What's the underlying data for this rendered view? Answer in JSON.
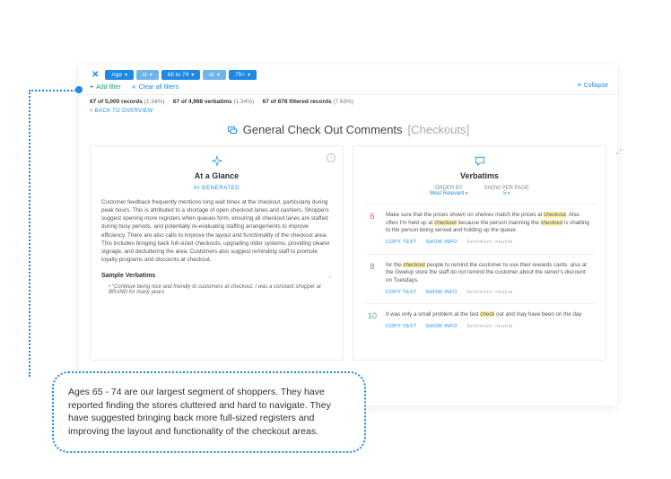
{
  "filters": {
    "close": "✕",
    "chips": [
      "Age",
      "is",
      "65 to 74",
      "or",
      "75+"
    ],
    "add": "Add filter",
    "clear": "Clear all filters",
    "collapse": "Collapse"
  },
  "records": {
    "a_bold": "67 of 5,000 records",
    "a_pct": "(1.34%)",
    "b_bold": "67 of 4,998 verbatims",
    "b_pct": "(1.34%)",
    "c_bold": "67 of 878 filtered records",
    "c_pct": "(7.63%)"
  },
  "back": "< BACK TO OVERVIEW",
  "title": {
    "main": "General Check Out Comments",
    "sub": "[Checkouts]"
  },
  "glance": {
    "heading": "At a Glance",
    "tag": "AI GENERATED",
    "body": "Customer feedback frequently mentions long wait times at the checkout, particularly during peak hours. This is attributed to a shortage of open checkout lanes and cashiers. Shoppers suggest opening more registers when queues form, ensuring all checkout lanes are staffed during busy periods, and potentially re-evaluating staffing arrangements to improve efficiency. There are also calls to improve the layout and functionality of the checkout area. This includes bringing back full-sized checkouts, upgrading older systems, providing clearer signage, and decluttering the area. Customers also suggest reminding staff to promote loyalty programs and discounts at checkout.",
    "sample_hdr": "Sample Verbatims",
    "quote": "\"Continue being nice and friendly to customers at checkout. I was a constant shopper at BRAND for many years"
  },
  "verbatims": {
    "heading": "Verbatims",
    "order_lbl": "ORDER BY",
    "order_val": "Most Relevant",
    "perpage_lbl": "SHOW PER PAGE",
    "perpage_val": "5",
    "items": [
      {
        "score": "6",
        "cls": "bad",
        "pre": "Make sure that the prices shown on shelves match the prices at ",
        "hl1": "checkout",
        "mid1": ". Also often I'm held up at ",
        "hl2": "checkout",
        "post": " because the person manning the ",
        "hl3": "checkout",
        "tail": " is chatting to the person being served and holding up the queue."
      },
      {
        "score": "8",
        "cls": "mid",
        "pre": "for the ",
        "hl1": "checkout",
        "mid1": " people to remind the customer to use their rewards cards. also at the Gwelup store the staff do not remind the customer about the senior's discount on Tuesdays.",
        "hl2": "",
        "post": "",
        "hl3": "",
        "tail": ""
      },
      {
        "score": "10",
        "cls": "good",
        "pre": "It was only a small problem at the fast ",
        "hl1": "check",
        "mid1": " out and may have been on the day",
        "hl2": "",
        "post": "",
        "hl3": "",
        "tail": ""
      }
    ],
    "copy": "COPY TEXT",
    "showinfo": "SHOW INFO",
    "sentiment": "Sentiment: neutral"
  },
  "callout": "Ages  65 - 74 are our largest segment of shoppers. They have reported finding the stores cluttered and hard to navigate. They have suggested bringing back more full-sized registers and improving the layout and functionality of the checkout areas."
}
